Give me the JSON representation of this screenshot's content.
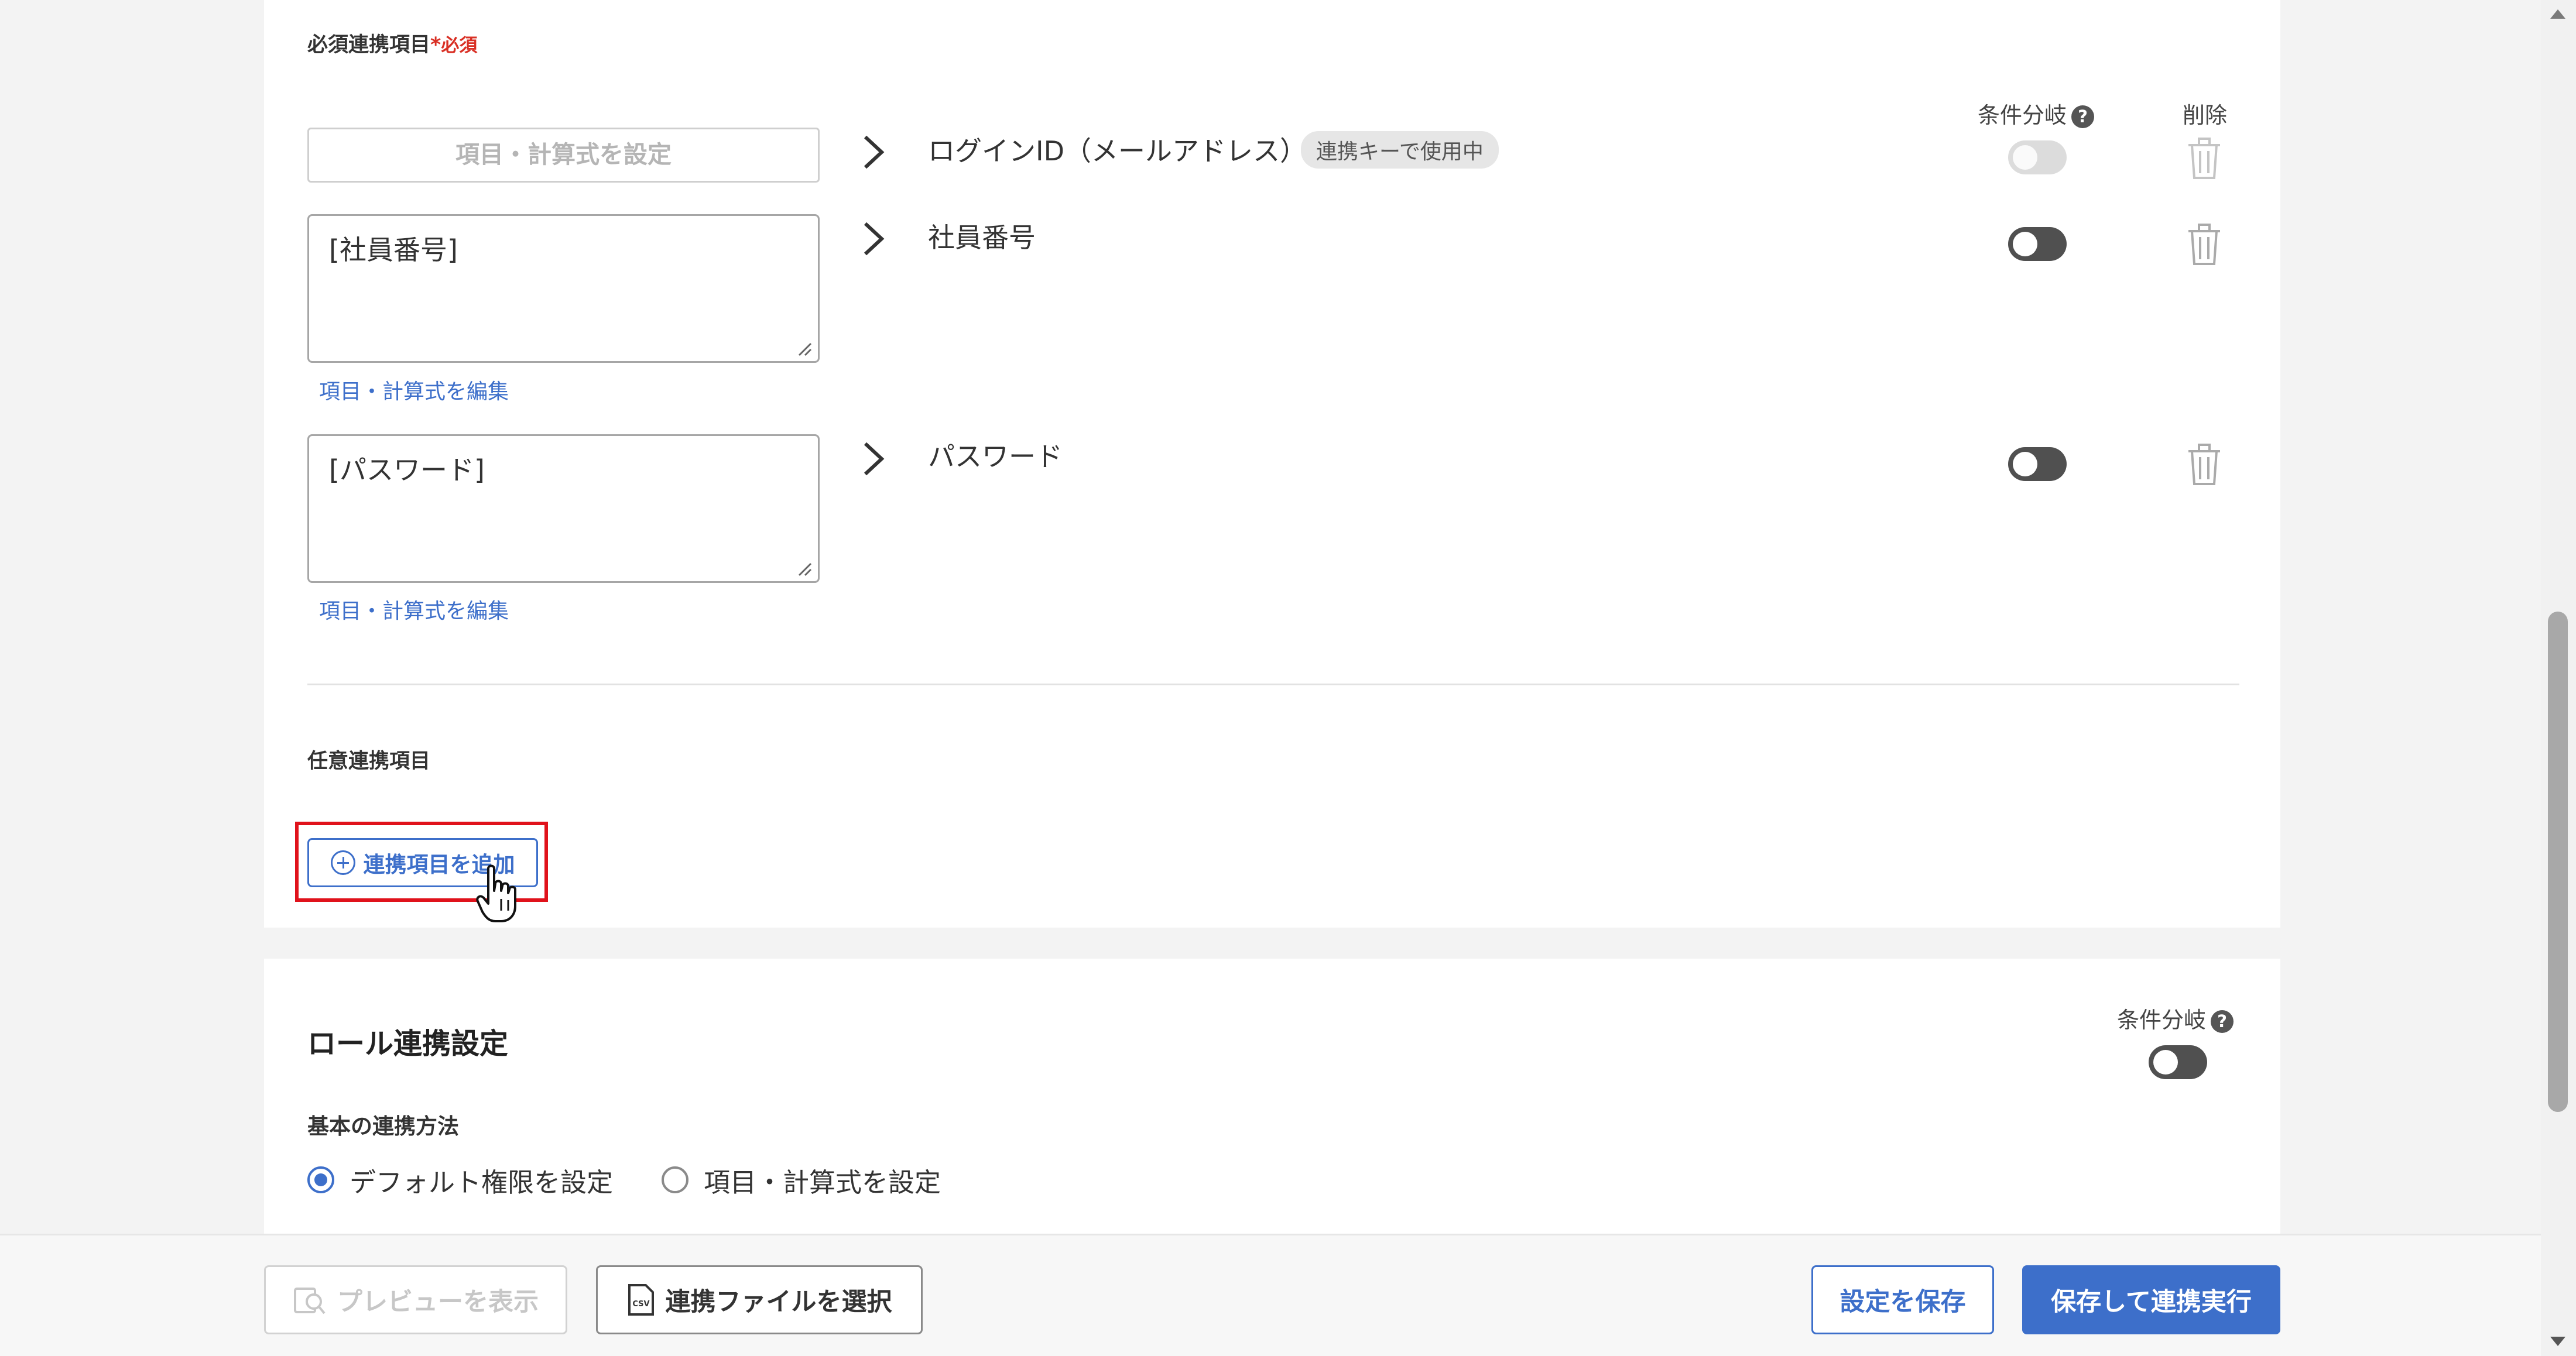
{
  "required_section": {
    "label": "必須連携項目",
    "star": "*",
    "badge": "必須",
    "col_condition": "条件分岐",
    "col_delete": "削除",
    "rows": [
      {
        "source_placeholder": "項目・計算式を設定",
        "source_value": "",
        "target": "ログインID（メールアドレス）",
        "key_badge": "連携キーで使用中",
        "edit_link": ""
      },
      {
        "source_placeholder": "",
        "source_value": "[社員番号]",
        "target": "社員番号",
        "key_badge": "",
        "edit_link": "項目・計算式を編集"
      },
      {
        "source_placeholder": "",
        "source_value": "[パスワード]",
        "target": "パスワード",
        "key_badge": "",
        "edit_link": "項目・計算式を編集"
      }
    ]
  },
  "optional_section": {
    "label": "任意連携項目",
    "add_button": "連携項目を追加"
  },
  "role_section": {
    "title": "ロール連携設定",
    "col_condition": "条件分岐",
    "method_label": "基本の連携方法",
    "options": [
      {
        "label": "デフォルト権限を設定",
        "checked": true
      },
      {
        "label": "項目・計算式を設定",
        "checked": false
      }
    ]
  },
  "footer": {
    "preview_button": "プレビューを表示",
    "select_file_button": "連携ファイルを選択",
    "csv_icon_text": "CSV",
    "save_button": "設定を保存",
    "save_run_button": "保存して連携実行"
  },
  "colors": {
    "accent": "#3d6fca",
    "required": "#d93025",
    "highlight": "#e0121b",
    "toggle_on": "#505050"
  }
}
